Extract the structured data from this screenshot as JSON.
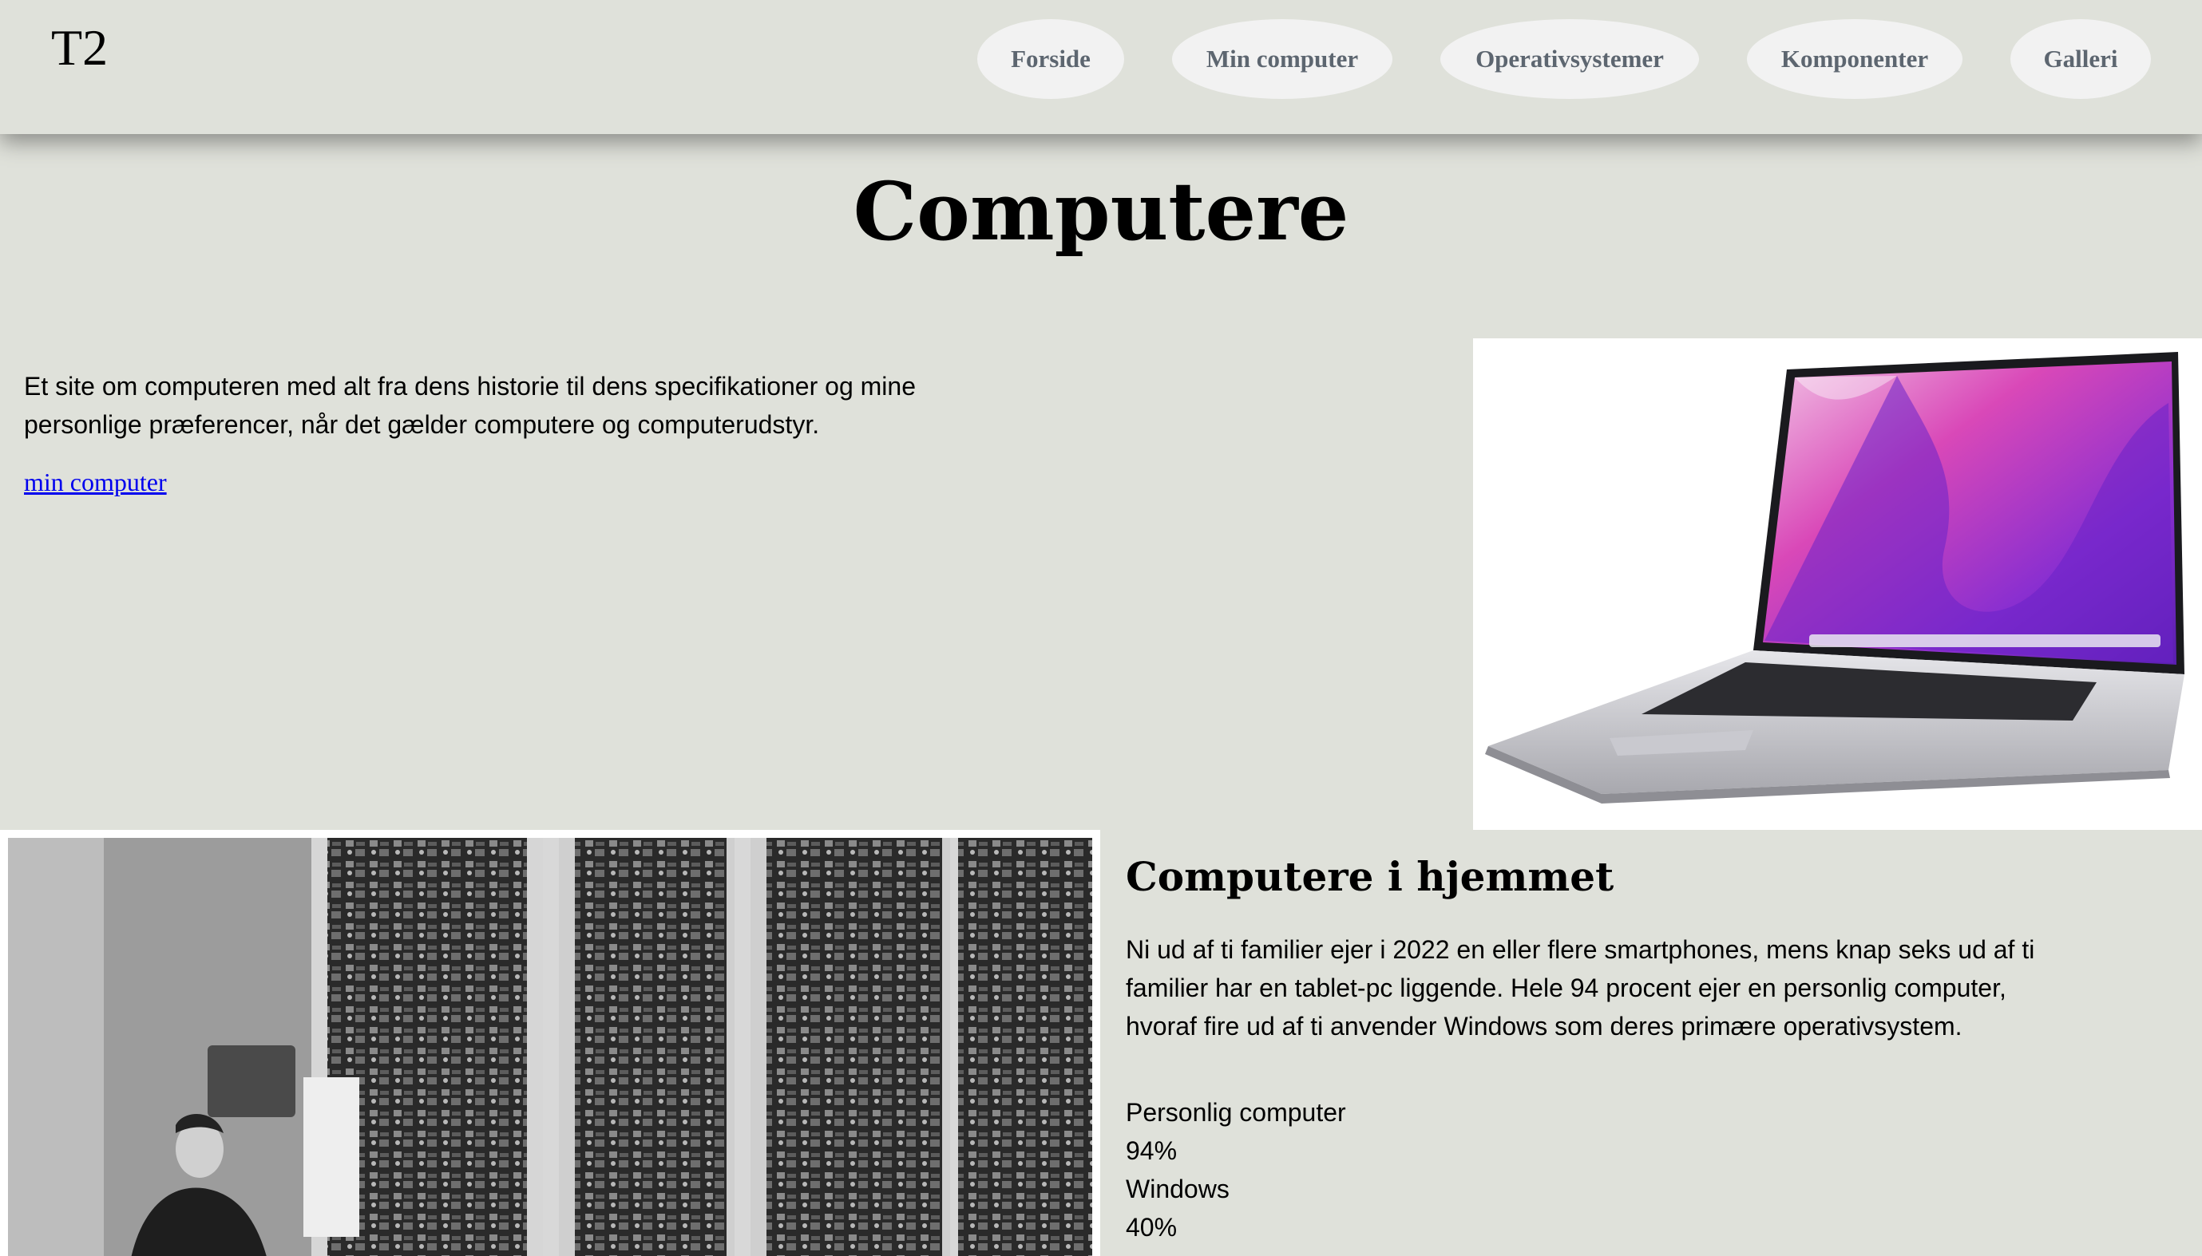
{
  "header": {
    "logo": "T2",
    "nav": [
      "Forside",
      "Min computer",
      "Operativsystemer",
      "Komponenter",
      "Galleri"
    ]
  },
  "main": {
    "title": "Computere",
    "intro_text": "Et site om computeren med alt fra dens historie til dens specifikationer og mine personlige præferencer, når det gælder computere og computerudstyr.",
    "intro_link": "min computer"
  },
  "home_section": {
    "title": "Computere i hjemmet",
    "text": "Ni ud af ti familier ejer i 2022 en eller flere smartphones, mens knap seks ud af ti familier har en tablet-pc liggende. Hele 94 procent ejer en personlig computer, hvoraf fire ud af ti anvender Windows som deres primære operativsystem.",
    "stats": [
      {
        "label": "Personlig computer",
        "value": "94%"
      },
      {
        "label": "Windows",
        "value": "40%"
      }
    ]
  },
  "colors": {
    "background": "#dfe1da",
    "nav_pill": "#f2f2f2",
    "nav_text": "#5d6670",
    "link": "#0000ee"
  }
}
